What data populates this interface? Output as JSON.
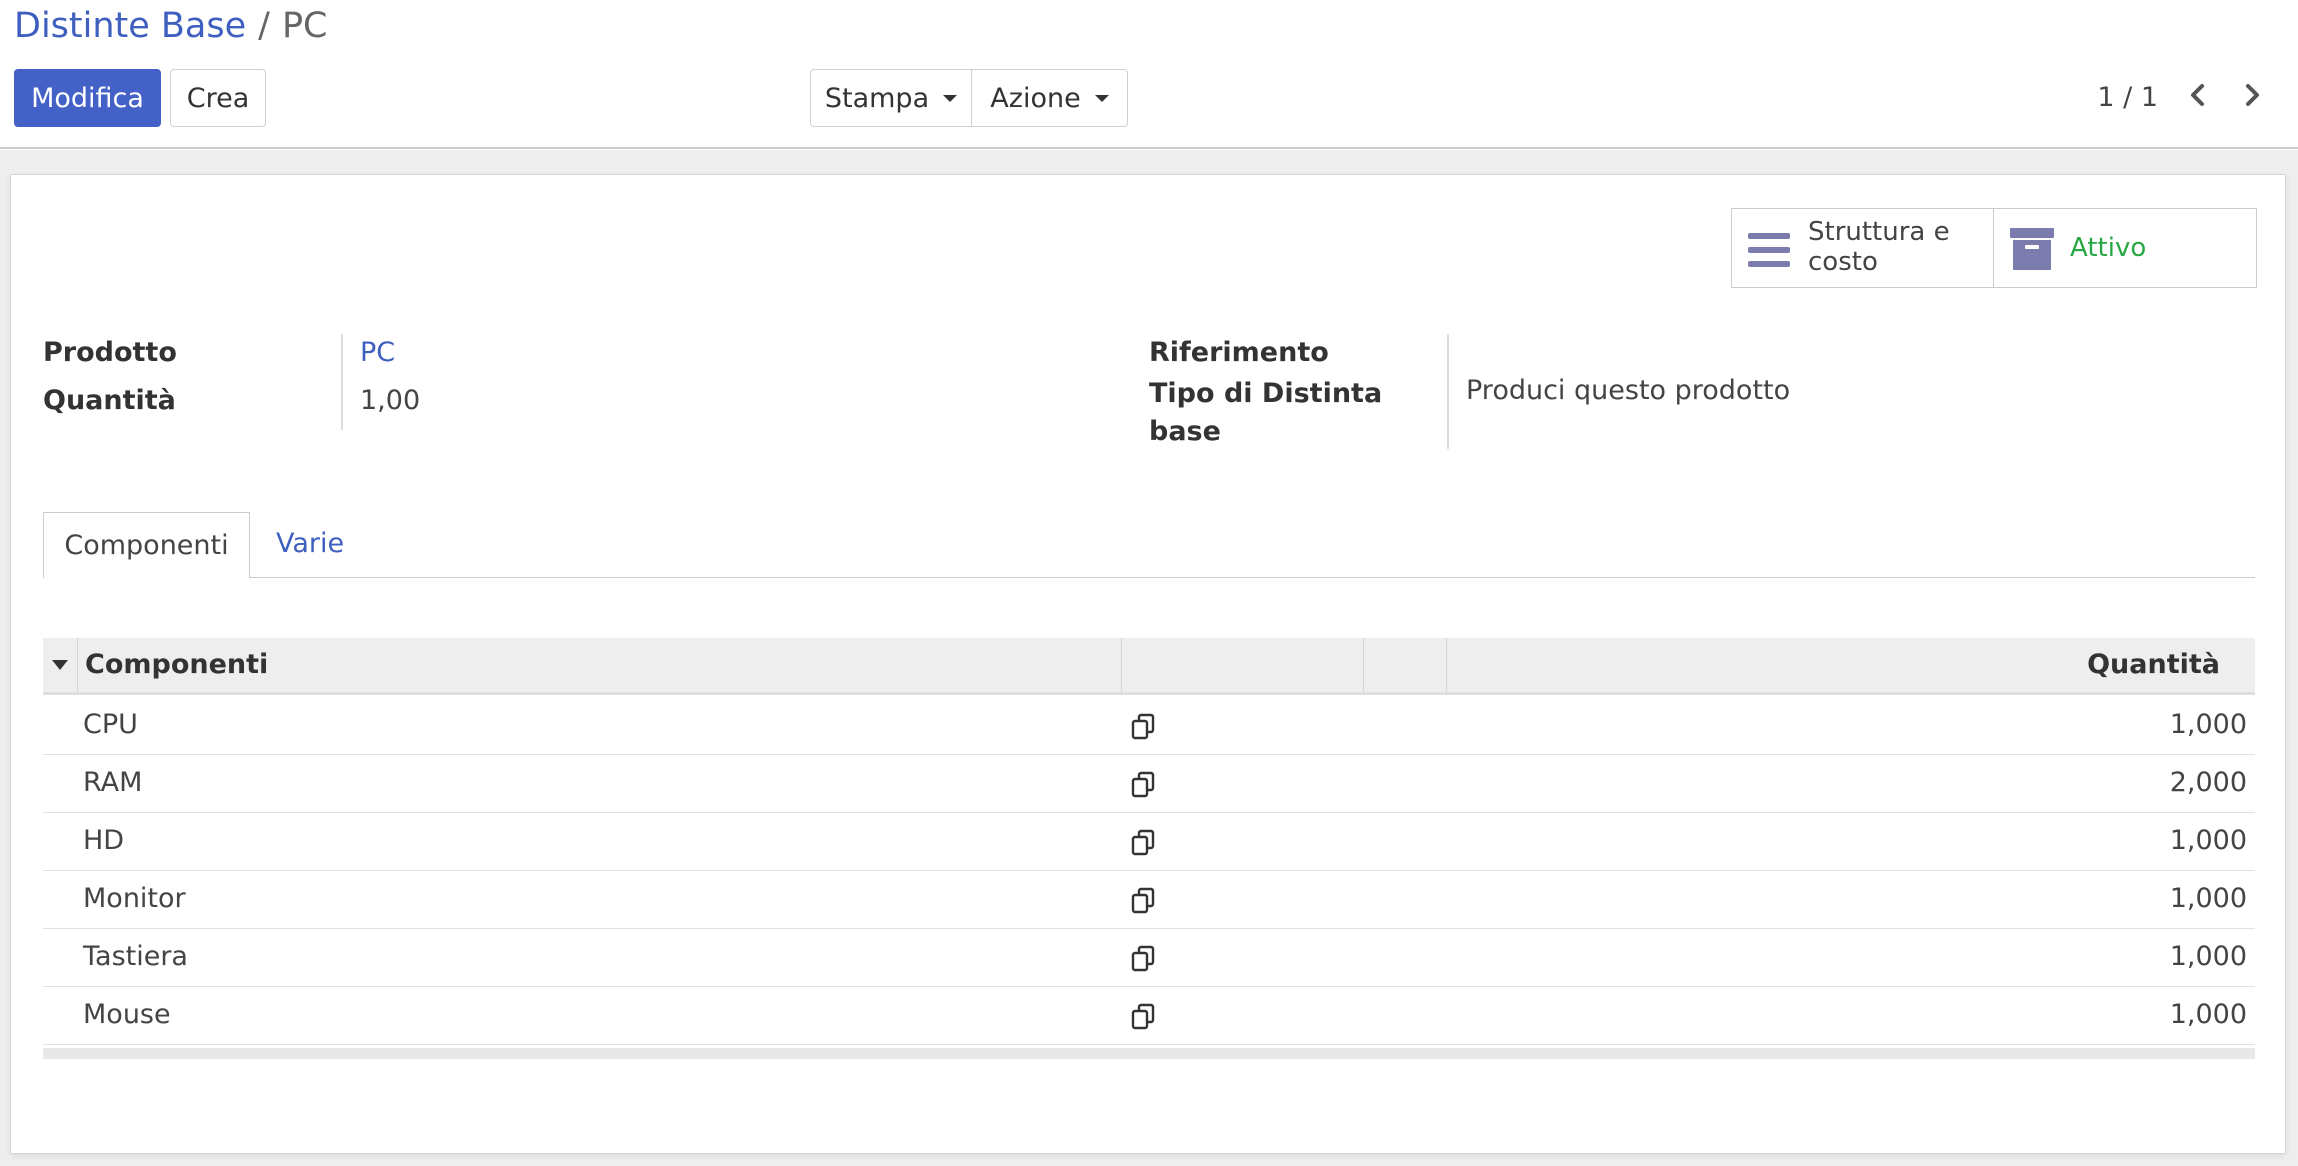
{
  "breadcrumb": {
    "parent": "Distinte Base",
    "separator": "/",
    "current": "PC"
  },
  "buttons": {
    "edit": "Modifica",
    "create": "Crea",
    "print": "Stampa",
    "action": "Azione"
  },
  "pager": {
    "value": "1 / 1"
  },
  "smart_buttons": {
    "structure_line1": "Struttura e",
    "structure_line2": "costo",
    "active": "Attivo"
  },
  "fields": {
    "product_label": "Prodotto",
    "product_value": "PC",
    "quantity_label": "Quantità",
    "quantity_value": "1,00",
    "reference_label": "Riferimento",
    "bom_type_label_line1": "Tipo di Distinta",
    "bom_type_label_line2": "base",
    "bom_type_value": "Produci questo prodotto"
  },
  "tabs": [
    "Componenti",
    "Varie"
  ],
  "table": {
    "headers": {
      "component": "Componenti",
      "quantity": "Quantità"
    },
    "rows": [
      {
        "name": "CPU",
        "qty": "1,000"
      },
      {
        "name": "RAM",
        "qty": "2,000"
      },
      {
        "name": "HD",
        "qty": "1,000"
      },
      {
        "name": "Monitor",
        "qty": "1,000"
      },
      {
        "name": "Tastiera",
        "qty": "1,000"
      },
      {
        "name": "Mouse",
        "qty": "1,000"
      }
    ]
  },
  "colors": {
    "link": "#3f5fbf",
    "primary": "#4461c7",
    "active": "#28a745",
    "icon": "#7c7bad"
  },
  "icons": {
    "prev": "chevron-left-icon",
    "next": "chevron-right-icon",
    "structure": "bars-icon",
    "archive": "archive-icon",
    "sort": "caret-down-icon",
    "clone": "copy-icon"
  }
}
